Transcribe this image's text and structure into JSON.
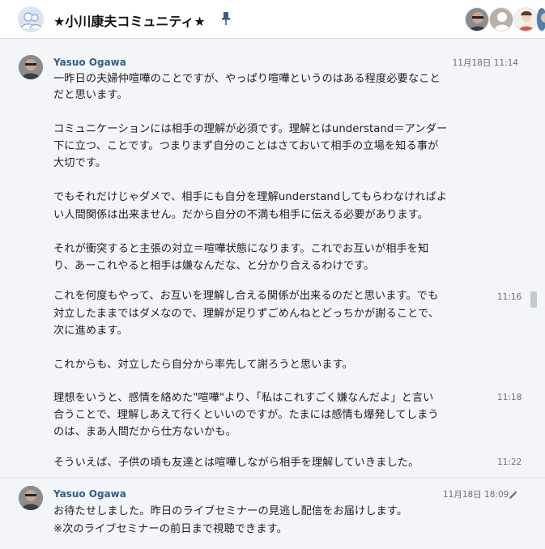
{
  "room": {
    "title": "★小川康夫コミュニティ★"
  },
  "members": [
    {
      "name": "member-avatar-yasuo"
    },
    {
      "name": "member-avatar-default"
    },
    {
      "name": "member-avatar-woman"
    },
    {
      "name": "member-avatar-partial"
    }
  ],
  "messages": {
    "m1": {
      "sender": "Yasuo Ogawa",
      "time": "11月18日 11:14",
      "lines": [
        "一昨日の夫婦仲喧嘩のことですが、やっぱり喧嘩というのはある程度必要なこと",
        "だと思います。",
        "コミュニケーションには相手の理解が必須です。理解とはunderstand＝アンダー",
        "下に立つ、ことです。つまりまず自分のことはさておいて相手の立場を知る事が",
        "大切です。",
        "でもそれだけじゃダメで、相手にも自分を理解understandしてもらわなければよ",
        "い人間関係は出来ません。だから自分の不満も相手に伝える必要があります。",
        "それが衝突すると主張の対立＝喧嘩状態になります。これでお互いが相手を知",
        "り、あーこれやると相手は嫌なんだな、と分かり合えるわけです。"
      ]
    },
    "m2": {
      "time": "11:16",
      "lines": [
        "これを何度もやって、お互いを理解し合える関係が出来るのだと思います。でも",
        "対立したままではダメなので、理解が足りずごめんねとどっちかが謝ることで、",
        "次に進めます。",
        "これからも、対立したら自分から率先して謝ろうと思います。"
      ]
    },
    "m3": {
      "time": "11:18",
      "lines": [
        "理想をいうと、感情を絡めた\"喧嘩\"より、「私はこれすごく嫌なんだよ」と言い",
        "合うことで、理解しあえて行くといいのですが。たまには感情も爆発してしまう",
        "のは、まあ人間だから仕方ないかも。"
      ]
    },
    "m4": {
      "time": "11:22",
      "lines": [
        "そういえば、子供の頃も友達とは喧嘩しながら相手を理解していきました。"
      ]
    },
    "m5": {
      "sender": "Yasuo Ogawa",
      "time": "11月18日 18:09",
      "lines": [
        " お待たせしました。昨日のライブセミナーの見逃し配信をお届けします。",
        "※次のライブセミナーの前日まで視聴できます。"
      ]
    }
  },
  "colors": {
    "accent": "#355c8a",
    "background": "#f3f5f8",
    "header": "#ffffff"
  }
}
